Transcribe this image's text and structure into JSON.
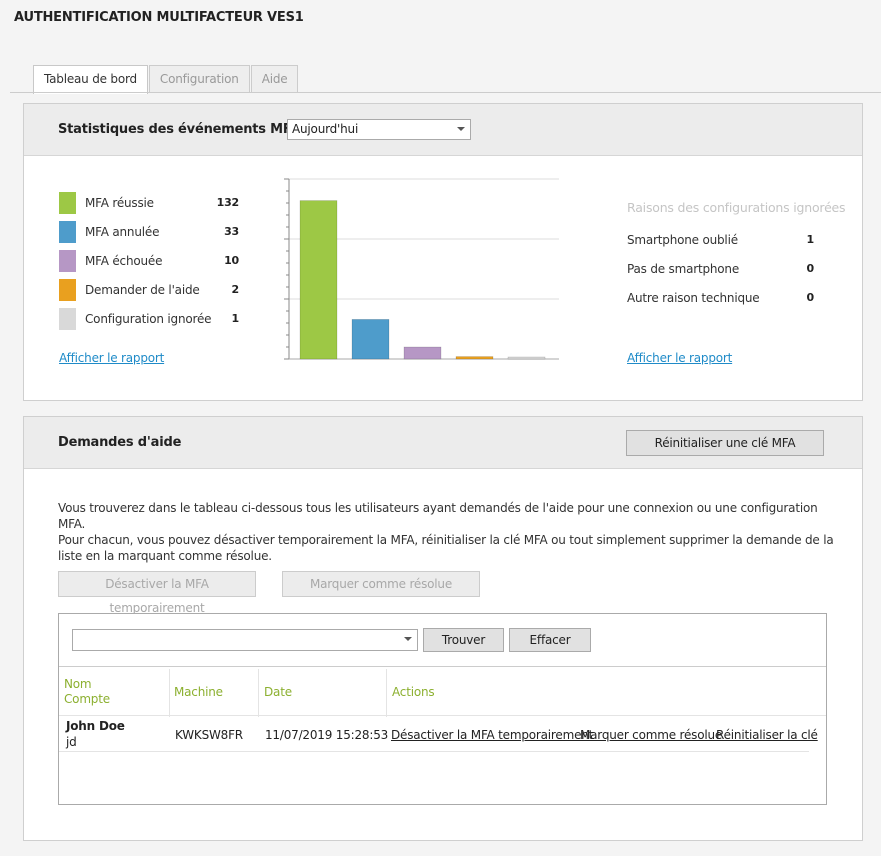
{
  "app": {
    "title": "AUTHENTIFICATION MULTIFACTEUR  VES1"
  },
  "tabs": [
    {
      "label": "Tableau de bord",
      "active": true
    },
    {
      "label": "Configuration",
      "active": false
    },
    {
      "label": "Aide",
      "active": false
    }
  ],
  "stats": {
    "title": "Statistiques des événements MFA",
    "period": {
      "selected": "Aujourd'hui"
    },
    "legend": [
      {
        "label": "MFA réussie",
        "value": 132,
        "color": "#9dc845"
      },
      {
        "label": "MFA annulée",
        "value": 33,
        "color": "#4e9ccb"
      },
      {
        "label": "MFA échouée",
        "value": 10,
        "color": "#b697c5"
      },
      {
        "label": "Demander de l'aide",
        "value": 2,
        "color": "#e9a01f"
      },
      {
        "label": "Configuration ignorée",
        "value": 1,
        "color": "#d9d9d9"
      }
    ],
    "report_link": "Afficher le rapport",
    "reasons": {
      "title": "Raisons des configurations ignorées",
      "items": [
        {
          "label": "Smartphone oublié",
          "value": 1
        },
        {
          "label": "Pas de smartphone",
          "value": 0
        },
        {
          "label": "Autre raison technique",
          "value": 0
        }
      ],
      "report_link": "Afficher le rapport"
    }
  },
  "chart_data": {
    "type": "bar",
    "categories": [
      "MFA réussie",
      "MFA annulée",
      "MFA échouée",
      "Demander de l'aide",
      "Configuration ignorée"
    ],
    "values": [
      132,
      33,
      10,
      2,
      1
    ],
    "colors": [
      "#9dc845",
      "#4e9ccb",
      "#b697c5",
      "#e9a01f",
      "#d9d9d9"
    ],
    "ylim": [
      0,
      150
    ],
    "grid": true,
    "title": "",
    "xlabel": "",
    "ylabel": ""
  },
  "help": {
    "title": "Demandes d'aide",
    "reset_button": "Réinitialiser une clé MFA",
    "description": [
      "Vous trouverez dans le tableau ci-dessous tous les utilisateurs ayant demandés de l'aide pour une connexion ou une configuration MFA.",
      "Pour chacun, vous pouvez désactiver temporairement la MFA, réinitialiser la clé MFA ou tout simplement supprimer la demande de la liste en la marquant comme résolue."
    ],
    "disable_button": "Désactiver la MFA temporairement",
    "resolve_button": "Marquer comme résolue",
    "search": {
      "value": "",
      "find_button": "Trouver",
      "clear_button": "Effacer"
    },
    "columns": {
      "name_line1": "Nom",
      "name_line2": "Compte",
      "machine": "Machine",
      "date": "Date",
      "actions": "Actions"
    },
    "rows": [
      {
        "name": "John Doe",
        "account": "jd",
        "machine": "KWKSW8FR",
        "date": "11/07/2019 15:28:53",
        "actions": [
          "Désactiver la MFA temporairement",
          "Marquer comme résolue",
          "Réinitialiser la clé"
        ]
      }
    ]
  }
}
